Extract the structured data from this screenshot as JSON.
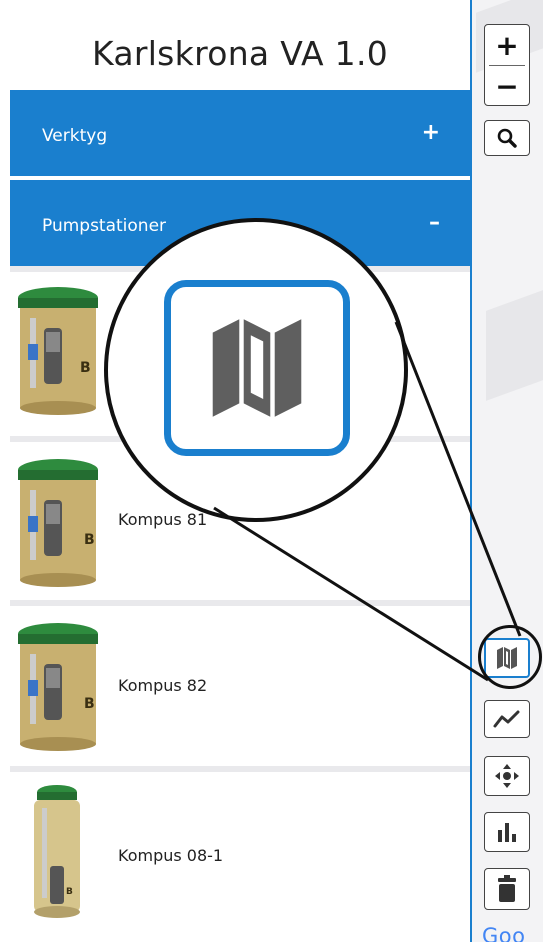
{
  "app": {
    "title": "Karlskrona VA 1.0"
  },
  "panels": [
    {
      "label": "Verktyg",
      "toggle": "+"
    },
    {
      "label": "Pumpstationer",
      "toggle": "–"
    }
  ],
  "pump_stations": [
    {
      "label": ""
    },
    {
      "label": "Kompus 81"
    },
    {
      "label": "Kompus 82"
    },
    {
      "label": "Kompus 08-1"
    }
  ],
  "map_controls": {
    "zoom_in": "+",
    "zoom_out": "−",
    "tools": [
      "search-icon",
      "map-icon",
      "line-chart-icon",
      "move-icon",
      "bar-chart-icon",
      "trash-icon"
    ]
  },
  "attribution": {
    "google_partial": "Goo"
  },
  "colors": {
    "accent": "#1a7fce",
    "panel_text": "#ffffff",
    "tank_green": "#2e8b3e",
    "tank_body": "#c8b070"
  }
}
